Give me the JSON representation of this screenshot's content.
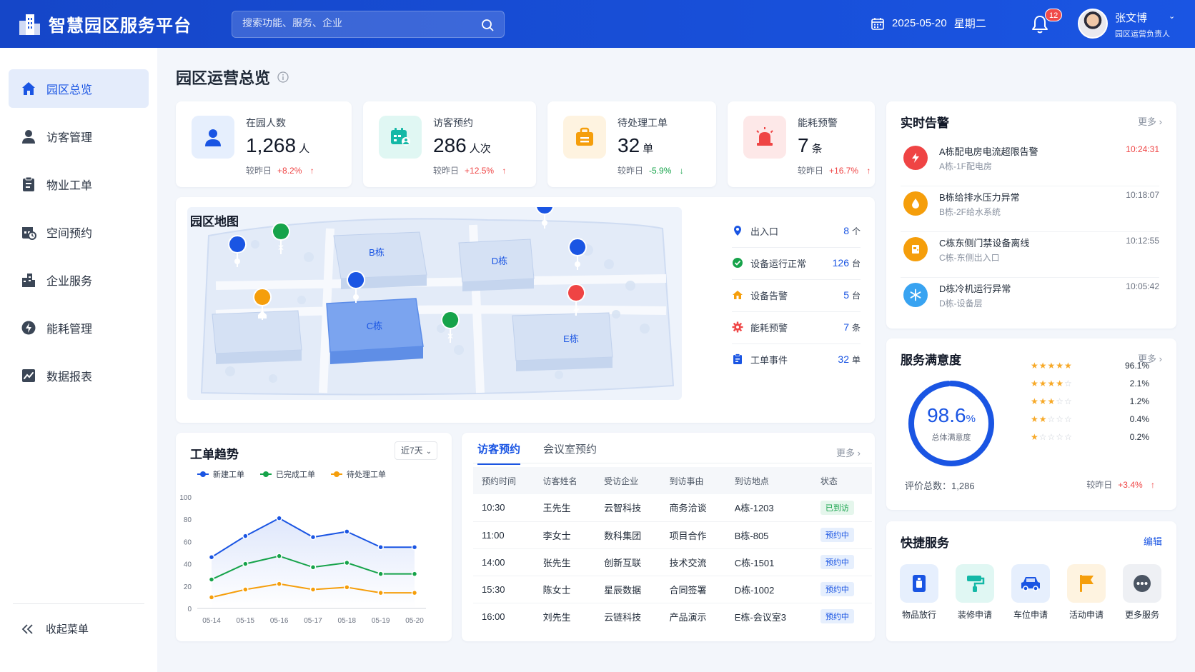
{
  "app": {
    "title": "智慧园区服务平台",
    "search_placeholder": "搜索功能、服务、企业",
    "date": "2025-05-20",
    "weekday": "星期二",
    "notification_count": "12",
    "user": {
      "name": "张文博",
      "role": "园区运营负责人"
    }
  },
  "sidebar": {
    "items": [
      {
        "label": "园区总览",
        "icon": "home-icon",
        "active": true
      },
      {
        "label": "访客管理",
        "icon": "user-icon",
        "active": false
      },
      {
        "label": "物业工单",
        "icon": "clipboard-icon",
        "active": false
      },
      {
        "label": "空间预约",
        "icon": "calendar-icon",
        "active": false
      },
      {
        "label": "企业服务",
        "icon": "building-icon",
        "active": false
      },
      {
        "label": "能耗管理",
        "icon": "energy-icon",
        "active": false
      },
      {
        "label": "数据报表",
        "icon": "chart-icon",
        "active": false
      }
    ],
    "collapse_label": "收起菜单"
  },
  "page": {
    "title": "园区运营总览"
  },
  "stats": [
    {
      "label": "在园人数",
      "value": "1,268",
      "unit": "人",
      "compare": "较昨日",
      "change": "+8.2%",
      "direction": "up",
      "icon": "person-icon",
      "color": "#1a55e3"
    },
    {
      "label": "访客预约",
      "value": "286",
      "unit": "人次",
      "compare": "较昨日",
      "change": "+12.5%",
      "direction": "up",
      "icon": "visitor-calendar-icon",
      "color": "#14b8a6"
    },
    {
      "label": "待处理工单",
      "value": "32",
      "unit": "单",
      "compare": "较昨日",
      "change": "-5.9%",
      "direction": "down",
      "icon": "briefcase-icon",
      "color": "#f59e0b"
    },
    {
      "label": "能耗预警",
      "value": "7",
      "unit": "条",
      "compare": "较昨日",
      "change": "+16.7%",
      "direction": "up",
      "icon": "alarm-icon",
      "color": "#ef4444"
    }
  ],
  "map": {
    "title": "园区地图",
    "buildings": [
      "B栋",
      "D栋",
      "C栋",
      "E栋"
    ],
    "legend": [
      {
        "label": "出入口",
        "value": "8",
        "unit": "个",
        "icon": "location-pin-icon",
        "color": "#1a55e3"
      },
      {
        "label": "设备运行正常",
        "value": "126",
        "unit": "台",
        "icon": "check-circle-icon",
        "color": "#16a34a"
      },
      {
        "label": "设备告警",
        "value": "5",
        "unit": "台",
        "icon": "warning-home-icon",
        "color": "#f59e0b"
      },
      {
        "label": "能耗预警",
        "value": "7",
        "unit": "条",
        "icon": "gear-alert-icon",
        "color": "#ef4444"
      },
      {
        "label": "工单事件",
        "value": "32",
        "unit": "单",
        "icon": "clipboard-icon",
        "color": "#1a55e3"
      }
    ]
  },
  "trend": {
    "title": "工单趋势",
    "range": "近7天",
    "legend": [
      "新建工单",
      "已完成工单",
      "待处理工单"
    ]
  },
  "chart_data": {
    "type": "line",
    "title": "工单趋势",
    "categories": [
      "05-14",
      "05-15",
      "05-16",
      "05-17",
      "05-18",
      "05-19",
      "05-20"
    ],
    "series": [
      {
        "name": "新建工单",
        "color": "#1a55e3",
        "values": [
          46,
          65,
          81,
          64,
          69,
          55,
          55
        ]
      },
      {
        "name": "已完成工单",
        "color": "#16a34a",
        "values": [
          26,
          40,
          47,
          37,
          41,
          31,
          31
        ]
      },
      {
        "name": "待处理工单",
        "color": "#f59e0b",
        "values": [
          10,
          17,
          22,
          17,
          19,
          14,
          14
        ]
      }
    ],
    "ylim": [
      0,
      100
    ],
    "yticks": [
      0,
      20,
      40,
      60,
      80,
      100
    ],
    "grid": false,
    "legend_position": "top"
  },
  "visits": {
    "tabs": [
      "访客预约",
      "会议室预约"
    ],
    "more": "更多",
    "columns": [
      "预约时间",
      "访客姓名",
      "受访企业",
      "到访事由",
      "到访地点",
      "状态"
    ],
    "rows": [
      [
        "10:30",
        "王先生",
        "云智科技",
        "商务洽谈",
        "A栋-1203",
        "已到访"
      ],
      [
        "11:00",
        "李女士",
        "数科集团",
        "项目合作",
        "B栋-805",
        "预约中"
      ],
      [
        "14:00",
        "张先生",
        "创新互联",
        "技术交流",
        "C栋-1501",
        "预约中"
      ],
      [
        "15:30",
        "陈女士",
        "星辰数据",
        "合同签署",
        "D栋-1002",
        "预约中"
      ],
      [
        "16:00",
        "刘先生",
        "云链科技",
        "产品演示",
        "E栋-会议室3",
        "预约中"
      ]
    ]
  },
  "alerts": {
    "title": "实时告警",
    "more": "更多",
    "items": [
      {
        "title": "A栋配电房电流超限告警",
        "location": "A栋-1F配电房",
        "time": "10:24:31",
        "icon": "lightning-icon",
        "color": "#ef4444"
      },
      {
        "title": "B栋给排水压力异常",
        "location": "B栋-2F给水系统",
        "time": "10:18:07",
        "icon": "water-drop-icon",
        "color": "#f59e0b"
      },
      {
        "title": "C栋东侧门禁设备离线",
        "location": "C栋-东侧出入口",
        "time": "10:12:55",
        "icon": "door-icon",
        "color": "#f59e0b"
      },
      {
        "title": "D栋冷机运行异常",
        "location": "D栋-设备层",
        "time": "10:05:42",
        "icon": "snowflake-icon",
        "color": "#38a3f1"
      }
    ]
  },
  "satisfaction": {
    "title": "服务满意度",
    "more": "更多",
    "score": "98.6",
    "score_unit": "%",
    "score_label": "总体满意度",
    "score_fraction": 0.986,
    "ratings": [
      {
        "stars": 5,
        "pct": "96.1%"
      },
      {
        "stars": 4,
        "pct": "2.1%"
      },
      {
        "stars": 3,
        "pct": "1.2%"
      },
      {
        "stars": 2,
        "pct": "0.4%"
      },
      {
        "stars": 1,
        "pct": "0.2%"
      }
    ],
    "total_label": "评价总数：",
    "total": "1,286",
    "compare": "较昨日",
    "change": "+3.4%"
  },
  "quick": {
    "title": "快捷服务",
    "edit": "编辑",
    "items": [
      {
        "label": "物品放行",
        "icon": "package-icon",
        "color": "#1a55e3",
        "bg": "#e6effd"
      },
      {
        "label": "装修申请",
        "icon": "paint-roller-icon",
        "color": "#14b8a6",
        "bg": "#e0f7f3"
      },
      {
        "label": "车位申请",
        "icon": "car-icon",
        "color": "#1a55e3",
        "bg": "#e6effd"
      },
      {
        "label": "活动申请",
        "icon": "flag-icon",
        "color": "#f59e0b",
        "bg": "#fef3e0"
      },
      {
        "label": "更多服务",
        "icon": "more-icon",
        "color": "#4b5563",
        "bg": "#eef0f4"
      }
    ]
  }
}
